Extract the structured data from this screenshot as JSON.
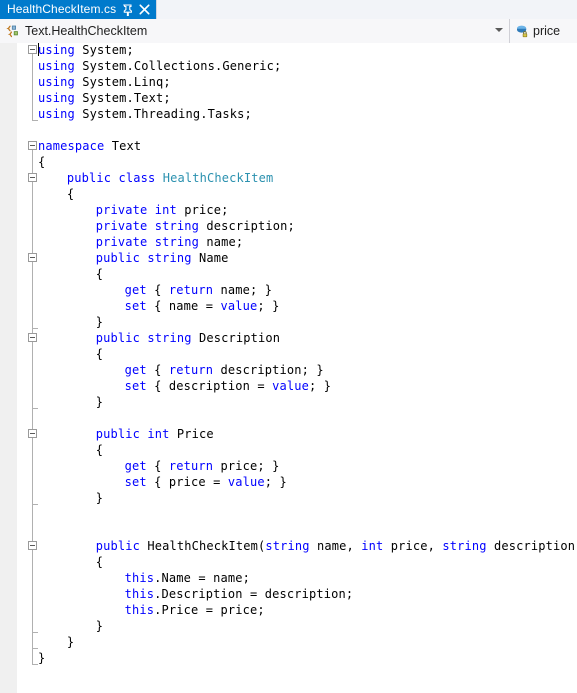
{
  "window": {
    "tab": {
      "title": "HealthCheckItem.cs",
      "pin_icon": "pin-icon",
      "close_icon": "close-icon",
      "active_color": "#007ACC"
    }
  },
  "navbar": {
    "class_icon": "class-namespace-icon",
    "scope": "Text.HealthCheckItem",
    "scope_caret_icon": "chevron-down-icon",
    "member_icon": "private-field-icon",
    "member": "price"
  },
  "editor": {
    "language": "csharp",
    "colors": {
      "keyword": "#0000FF",
      "type": "#2B91AF",
      "plain": "#000000",
      "background": "#FFFFFF",
      "current_line": "#F4F4F6",
      "margin": "#F0F0F0"
    },
    "char_width": 7.22,
    "line_height": 16,
    "top_offset": -1,
    "lines": [
      {
        "n": 1,
        "indent": 0,
        "tokens": [
          {
            "t": "using",
            "c": "kw"
          },
          {
            "t": " System;",
            "c": "pl"
          }
        ]
      },
      {
        "n": 2,
        "indent": 0,
        "tokens": [
          {
            "t": "using",
            "c": "kw"
          },
          {
            "t": " System.Collections.Generic;",
            "c": "pl"
          }
        ]
      },
      {
        "n": 3,
        "indent": 0,
        "tokens": [
          {
            "t": "using",
            "c": "kw"
          },
          {
            "t": " System.Linq;",
            "c": "pl"
          }
        ]
      },
      {
        "n": 4,
        "indent": 0,
        "tokens": [
          {
            "t": "using",
            "c": "kw"
          },
          {
            "t": " System.Text;",
            "c": "pl"
          }
        ]
      },
      {
        "n": 5,
        "indent": 0,
        "tokens": [
          {
            "t": "using",
            "c": "kw"
          },
          {
            "t": " System.Threading.Tasks;",
            "c": "pl"
          }
        ]
      },
      {
        "n": 6,
        "indent": 0,
        "tokens": []
      },
      {
        "n": 7,
        "indent": 0,
        "tokens": [
          {
            "t": "namespace",
            "c": "kw"
          },
          {
            "t": " Text",
            "c": "pl"
          }
        ]
      },
      {
        "n": 8,
        "indent": 0,
        "tokens": [
          {
            "t": "{",
            "c": "pl"
          }
        ]
      },
      {
        "n": 9,
        "indent": 4,
        "tokens": [
          {
            "t": "public class ",
            "c": "kw"
          },
          {
            "t": "HealthCheckItem",
            "c": "type"
          }
        ]
      },
      {
        "n": 10,
        "indent": 4,
        "tokens": [
          {
            "t": "{",
            "c": "pl"
          }
        ]
      },
      {
        "n": 11,
        "indent": 8,
        "tokens": [
          {
            "t": "private int",
            "c": "kw"
          },
          {
            "t": " price;",
            "c": "pl"
          }
        ]
      },
      {
        "n": 12,
        "indent": 8,
        "tokens": [
          {
            "t": "private string",
            "c": "kw"
          },
          {
            "t": " description;",
            "c": "pl"
          }
        ]
      },
      {
        "n": 13,
        "indent": 8,
        "tokens": [
          {
            "t": "private string",
            "c": "kw"
          },
          {
            "t": " name;",
            "c": "pl"
          }
        ]
      },
      {
        "n": 14,
        "indent": 8,
        "tokens": [
          {
            "t": "public string",
            "c": "kw"
          },
          {
            "t": " Name",
            "c": "pl"
          }
        ]
      },
      {
        "n": 15,
        "indent": 8,
        "tokens": [
          {
            "t": "{",
            "c": "pl"
          }
        ]
      },
      {
        "n": 16,
        "indent": 12,
        "tokens": [
          {
            "t": "get",
            "c": "kw"
          },
          {
            "t": " { ",
            "c": "pl"
          },
          {
            "t": "return",
            "c": "kw"
          },
          {
            "t": " name; }",
            "c": "pl"
          }
        ]
      },
      {
        "n": 17,
        "indent": 12,
        "tokens": [
          {
            "t": "set",
            "c": "kw"
          },
          {
            "t": " { name = ",
            "c": "pl"
          },
          {
            "t": "value",
            "c": "kw"
          },
          {
            "t": "; }",
            "c": "pl"
          }
        ]
      },
      {
        "n": 18,
        "indent": 8,
        "tokens": [
          {
            "t": "}",
            "c": "pl"
          }
        ]
      },
      {
        "n": 19,
        "indent": 8,
        "tokens": [
          {
            "t": "public string",
            "c": "kw"
          },
          {
            "t": " Description",
            "c": "pl"
          }
        ]
      },
      {
        "n": 20,
        "indent": 8,
        "tokens": [
          {
            "t": "{",
            "c": "pl"
          }
        ]
      },
      {
        "n": 21,
        "indent": 12,
        "tokens": [
          {
            "t": "get",
            "c": "kw"
          },
          {
            "t": " { ",
            "c": "pl"
          },
          {
            "t": "return",
            "c": "kw"
          },
          {
            "t": " description; }",
            "c": "pl"
          }
        ]
      },
      {
        "n": 22,
        "indent": 12,
        "tokens": [
          {
            "t": "set",
            "c": "kw"
          },
          {
            "t": " { description = ",
            "c": "pl"
          },
          {
            "t": "value",
            "c": "kw"
          },
          {
            "t": "; }",
            "c": "pl"
          }
        ]
      },
      {
        "n": 23,
        "indent": 8,
        "tokens": [
          {
            "t": "}",
            "c": "pl"
          }
        ]
      },
      {
        "n": 24,
        "indent": 0,
        "tokens": []
      },
      {
        "n": 25,
        "indent": 8,
        "tokens": [
          {
            "t": "public int",
            "c": "kw"
          },
          {
            "t": " Price",
            "c": "pl"
          }
        ]
      },
      {
        "n": 26,
        "indent": 8,
        "tokens": [
          {
            "t": "{",
            "c": "pl"
          }
        ]
      },
      {
        "n": 27,
        "indent": 12,
        "tokens": [
          {
            "t": "get",
            "c": "kw"
          },
          {
            "t": " { ",
            "c": "pl"
          },
          {
            "t": "return",
            "c": "kw"
          },
          {
            "t": " price; }",
            "c": "pl"
          }
        ]
      },
      {
        "n": 28,
        "indent": 12,
        "tokens": [
          {
            "t": "set",
            "c": "kw"
          },
          {
            "t": " { price = ",
            "c": "pl"
          },
          {
            "t": "value",
            "c": "kw"
          },
          {
            "t": "; }",
            "c": "pl"
          }
        ]
      },
      {
        "n": 29,
        "indent": 8,
        "tokens": [
          {
            "t": "}",
            "c": "pl"
          }
        ]
      },
      {
        "n": 30,
        "indent": 0,
        "tokens": []
      },
      {
        "n": 31,
        "indent": 0,
        "tokens": []
      },
      {
        "n": 32,
        "indent": 8,
        "tokens": [
          {
            "t": "public",
            "c": "kw"
          },
          {
            "t": " HealthCheckItem(",
            "c": "pl"
          },
          {
            "t": "string",
            "c": "kw"
          },
          {
            "t": " name, ",
            "c": "pl"
          },
          {
            "t": "int",
            "c": "kw"
          },
          {
            "t": " price, ",
            "c": "pl"
          },
          {
            "t": "string",
            "c": "kw"
          },
          {
            "t": " description)",
            "c": "pl"
          }
        ]
      },
      {
        "n": 33,
        "indent": 8,
        "tokens": [
          {
            "t": "{",
            "c": "pl"
          }
        ]
      },
      {
        "n": 34,
        "indent": 12,
        "tokens": [
          {
            "t": "this",
            "c": "kw"
          },
          {
            "t": ".Name = name;",
            "c": "pl"
          }
        ]
      },
      {
        "n": 35,
        "indent": 12,
        "tokens": [
          {
            "t": "this",
            "c": "kw"
          },
          {
            "t": ".Description = description;",
            "c": "pl"
          }
        ]
      },
      {
        "n": 36,
        "indent": 12,
        "tokens": [
          {
            "t": "this",
            "c": "kw"
          },
          {
            "t": ".Price = price;",
            "c": "pl"
          }
        ]
      },
      {
        "n": 37,
        "indent": 8,
        "tokens": [
          {
            "t": "}",
            "c": "pl"
          }
        ]
      },
      {
        "n": 38,
        "indent": 4,
        "tokens": [
          {
            "t": "}",
            "c": "pl"
          }
        ]
      },
      {
        "n": 39,
        "indent": 0,
        "tokens": [
          {
            "t": "}",
            "c": "pl"
          }
        ]
      }
    ],
    "outlining": [
      {
        "line": 1,
        "x": 11,
        "collapsible": true,
        "span_to": 5
      },
      {
        "line": 7,
        "x": 11,
        "collapsible": true,
        "span_to": 39
      },
      {
        "line": 9,
        "x": 11,
        "collapsible": true,
        "span_to": 38
      },
      {
        "line": 14,
        "x": 11,
        "collapsible": true,
        "span_to": 18
      },
      {
        "line": 19,
        "x": 11,
        "collapsible": true,
        "span_to": 23
      },
      {
        "line": 25,
        "x": 11,
        "collapsible": true,
        "span_to": 29
      },
      {
        "line": 32,
        "x": 11,
        "collapsible": true,
        "span_to": 37
      }
    ],
    "caret": {
      "line": 1,
      "column": 0
    }
  }
}
